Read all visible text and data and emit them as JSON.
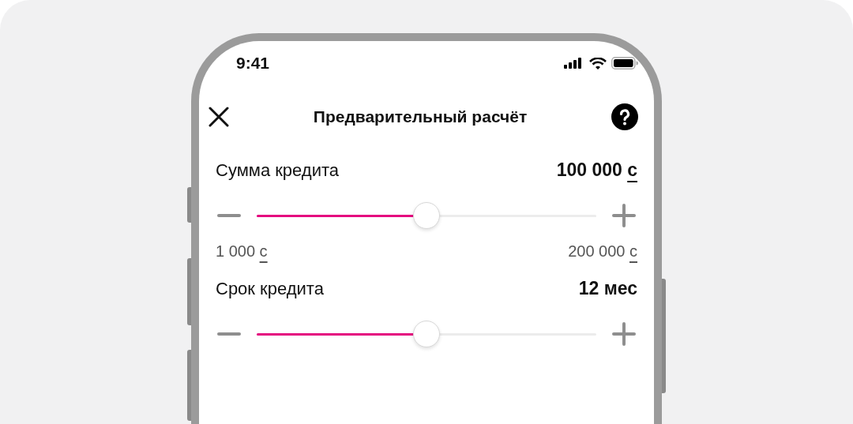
{
  "status_bar": {
    "time": "9:41"
  },
  "header": {
    "title": "Предварительный расчёт"
  },
  "sliders": [
    {
      "label": "Сумма кредита",
      "value": "100 000",
      "unit": "с",
      "level": 0.5,
      "min": {
        "value": "1 000",
        "unit": "с"
      },
      "max": {
        "value": "200 000",
        "unit": "с"
      }
    },
    {
      "label": "Срок кредита",
      "value": "12 мес",
      "level": 0.5
    }
  ]
}
